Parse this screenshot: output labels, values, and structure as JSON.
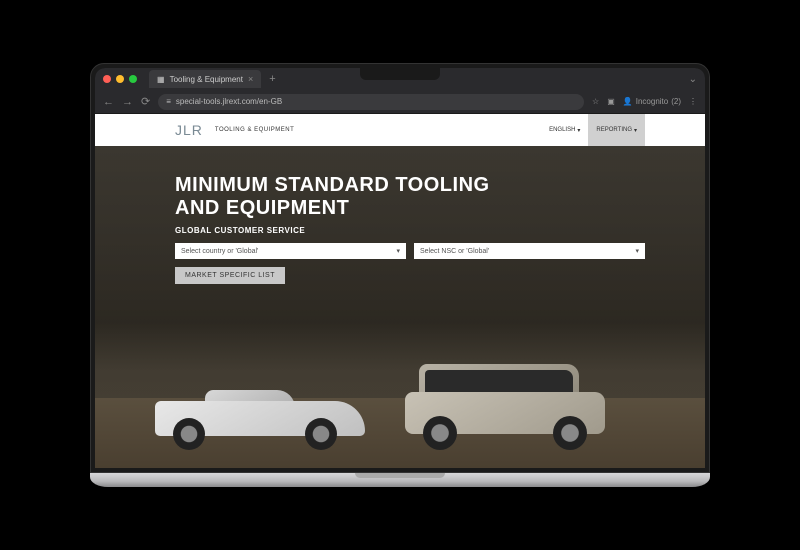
{
  "browser": {
    "tab_title": "Tooling & Equipment",
    "url": "special-tools.jlrext.com/en-GB",
    "incognito_label": "Incognito",
    "incognito_count": "(2)"
  },
  "header": {
    "logo_text": "JLR",
    "logo_subtitle": "TOOLING & EQUIPMENT",
    "nav": [
      {
        "label": "ENGLISH",
        "active": false
      },
      {
        "label": "REPORTING",
        "active": true
      }
    ]
  },
  "hero": {
    "title_line1": "MINIMUM STANDARD TOOLING",
    "title_line2": "AND EQUIPMENT",
    "subtitle": "GLOBAL CUSTOMER SERVICE",
    "select_country_placeholder": "Select country or 'Global'",
    "select_nsc_placeholder": "Select NSC or 'Global'",
    "button_label": "MARKET SPECIFIC LIST"
  }
}
